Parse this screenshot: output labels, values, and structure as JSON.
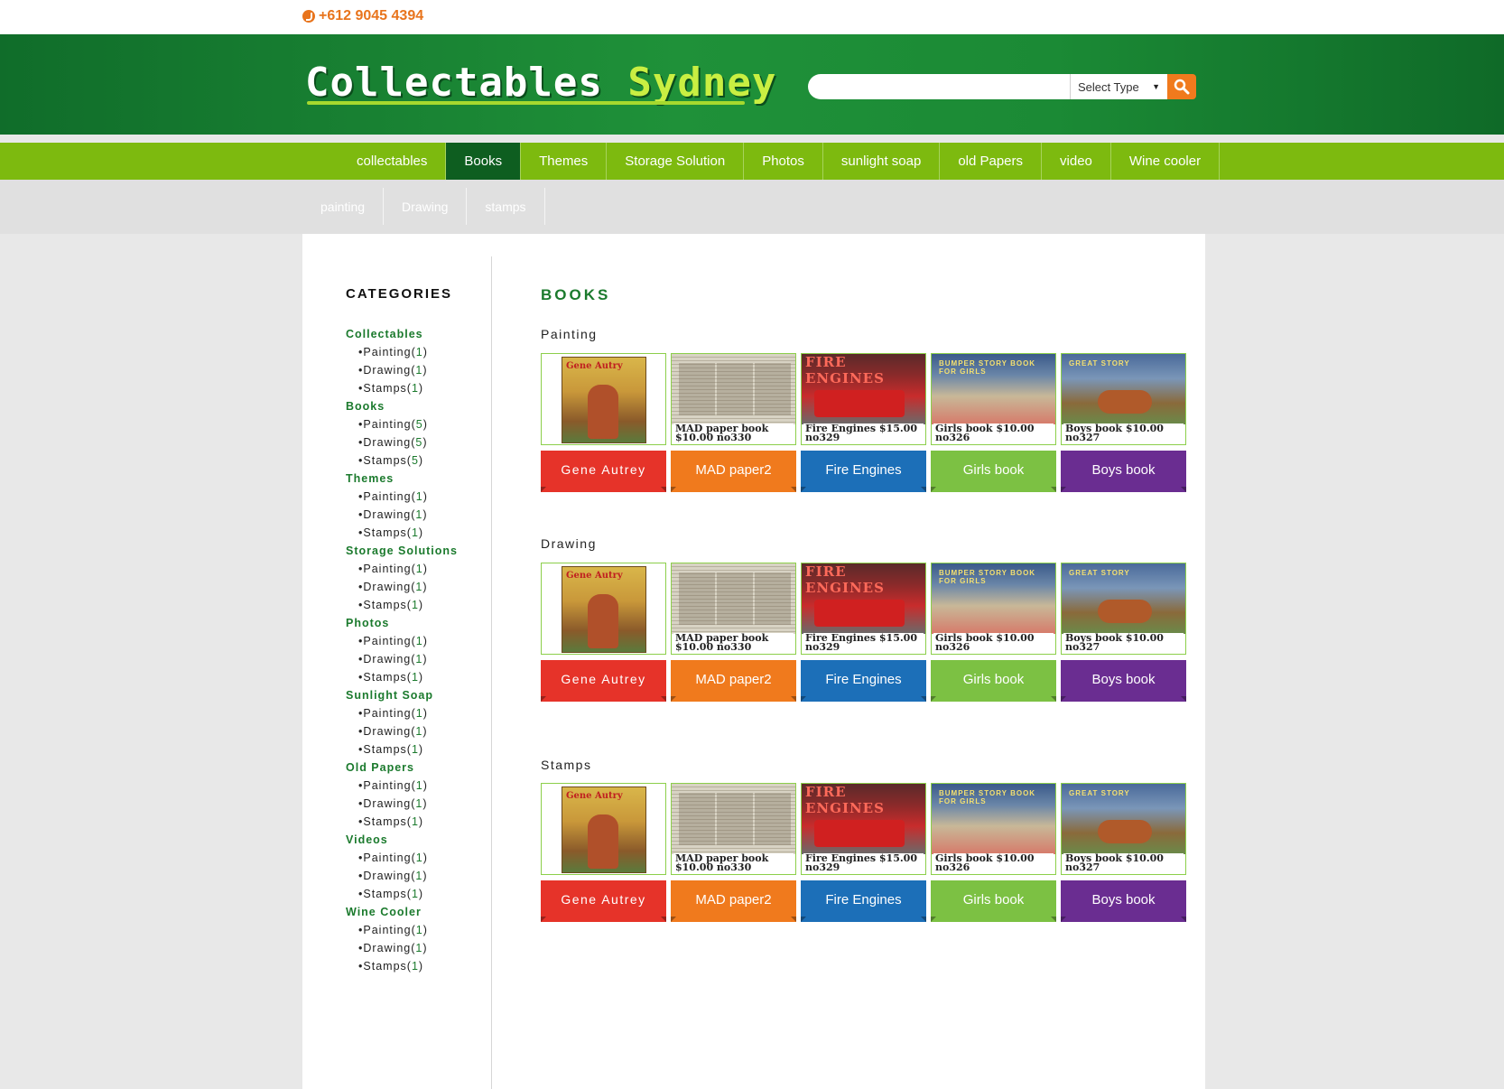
{
  "topbar": {
    "phone": "+612 9045 4394"
  },
  "header": {
    "logo_word1": "Collectables",
    "logo_word2": "Sydney",
    "search_placeholder": "",
    "select_label": "Select Type"
  },
  "nav": {
    "items": [
      {
        "label": "collectables"
      },
      {
        "label": "Books"
      },
      {
        "label": "Themes"
      },
      {
        "label": "Storage Solution"
      },
      {
        "label": "Photos"
      },
      {
        "label": "sunlight soap"
      },
      {
        "label": "old Papers"
      },
      {
        "label": "video"
      },
      {
        "label": "Wine cooler"
      }
    ],
    "active": "Books"
  },
  "subnav": {
    "items": [
      {
        "label": "painting"
      },
      {
        "label": "Drawing"
      },
      {
        "label": "stamps"
      }
    ]
  },
  "sidebar": {
    "title": "CATEGORIES",
    "categories": [
      {
        "name": "Collectables",
        "subs": [
          {
            "label": "Painting",
            "count": "1"
          },
          {
            "label": "Drawing",
            "count": "1"
          },
          {
            "label": "Stamps",
            "count": "1"
          }
        ]
      },
      {
        "name": "Books",
        "subs": [
          {
            "label": "Painting",
            "count": "5"
          },
          {
            "label": "Drawing",
            "count": "5"
          },
          {
            "label": "Stamps",
            "count": "5"
          }
        ]
      },
      {
        "name": "Themes",
        "subs": [
          {
            "label": "Painting",
            "count": "1"
          },
          {
            "label": "Drawing",
            "count": "1"
          },
          {
            "label": "Stamps",
            "count": "1"
          }
        ]
      },
      {
        "name": "Storage Solutions",
        "subs": [
          {
            "label": "Painting",
            "count": "1"
          },
          {
            "label": "Drawing",
            "count": "1"
          },
          {
            "label": "Stamps",
            "count": "1"
          }
        ]
      },
      {
        "name": "Photos",
        "subs": [
          {
            "label": "Painting",
            "count": "1"
          },
          {
            "label": "Drawing",
            "count": "1"
          },
          {
            "label": "Stamps",
            "count": "1"
          }
        ]
      },
      {
        "name": "Sunlight Soap",
        "subs": [
          {
            "label": "Painting",
            "count": "1"
          },
          {
            "label": "Drawing",
            "count": "1"
          },
          {
            "label": "Stamps",
            "count": "1"
          }
        ]
      },
      {
        "name": "Old Papers",
        "subs": [
          {
            "label": "Painting",
            "count": "1"
          },
          {
            "label": "Drawing",
            "count": "1"
          },
          {
            "label": "Stamps",
            "count": "1"
          }
        ]
      },
      {
        "name": "Videos",
        "subs": [
          {
            "label": "Painting",
            "count": "1"
          },
          {
            "label": "Drawing",
            "count": "1"
          },
          {
            "label": "Stamps",
            "count": "1"
          }
        ]
      },
      {
        "name": "Wine Cooler",
        "subs": [
          {
            "label": "Painting",
            "count": "1"
          },
          {
            "label": "Drawing",
            "count": "1"
          },
          {
            "label": "Stamps",
            "count": "1"
          }
        ]
      }
    ]
  },
  "main": {
    "title": "BOOKS",
    "sections": [
      {
        "title": "Painting"
      },
      {
        "title": "Drawing"
      },
      {
        "title": "Stamps"
      }
    ],
    "products": [
      {
        "name": "Gene Autrey",
        "thumb": "gene",
        "color": "#e63329",
        "cover_text": "Gene Autry",
        "caption": ""
      },
      {
        "name": "MAD paper2",
        "thumb": "paper",
        "color": "#f07a1d",
        "cover_text": "",
        "caption": "MAD paper book $10.00 no330"
      },
      {
        "name": "Fire Engines",
        "thumb": "fire",
        "color": "#1c6fb8",
        "cover_text": "FIRE ENGINES",
        "caption": "Fire Engines $15.00 no329"
      },
      {
        "name": "Girls book",
        "thumb": "girls",
        "color": "#7cc143",
        "cover_text": "BUMPER STORY BOOK FOR GIRLS",
        "caption": "Girls book $10.00 no326"
      },
      {
        "name": "Boys book",
        "thumb": "boys",
        "color": "#6a2d91",
        "cover_text": "GREAT STORY",
        "caption": "Boys book $10.00 no327"
      }
    ]
  },
  "colors": {
    "header_green": "#1f9139",
    "nav_green": "#7dba0f",
    "active_nav": "#0e5e20",
    "accent_orange": "#f07a1d",
    "category_green": "#1b7a2d"
  }
}
